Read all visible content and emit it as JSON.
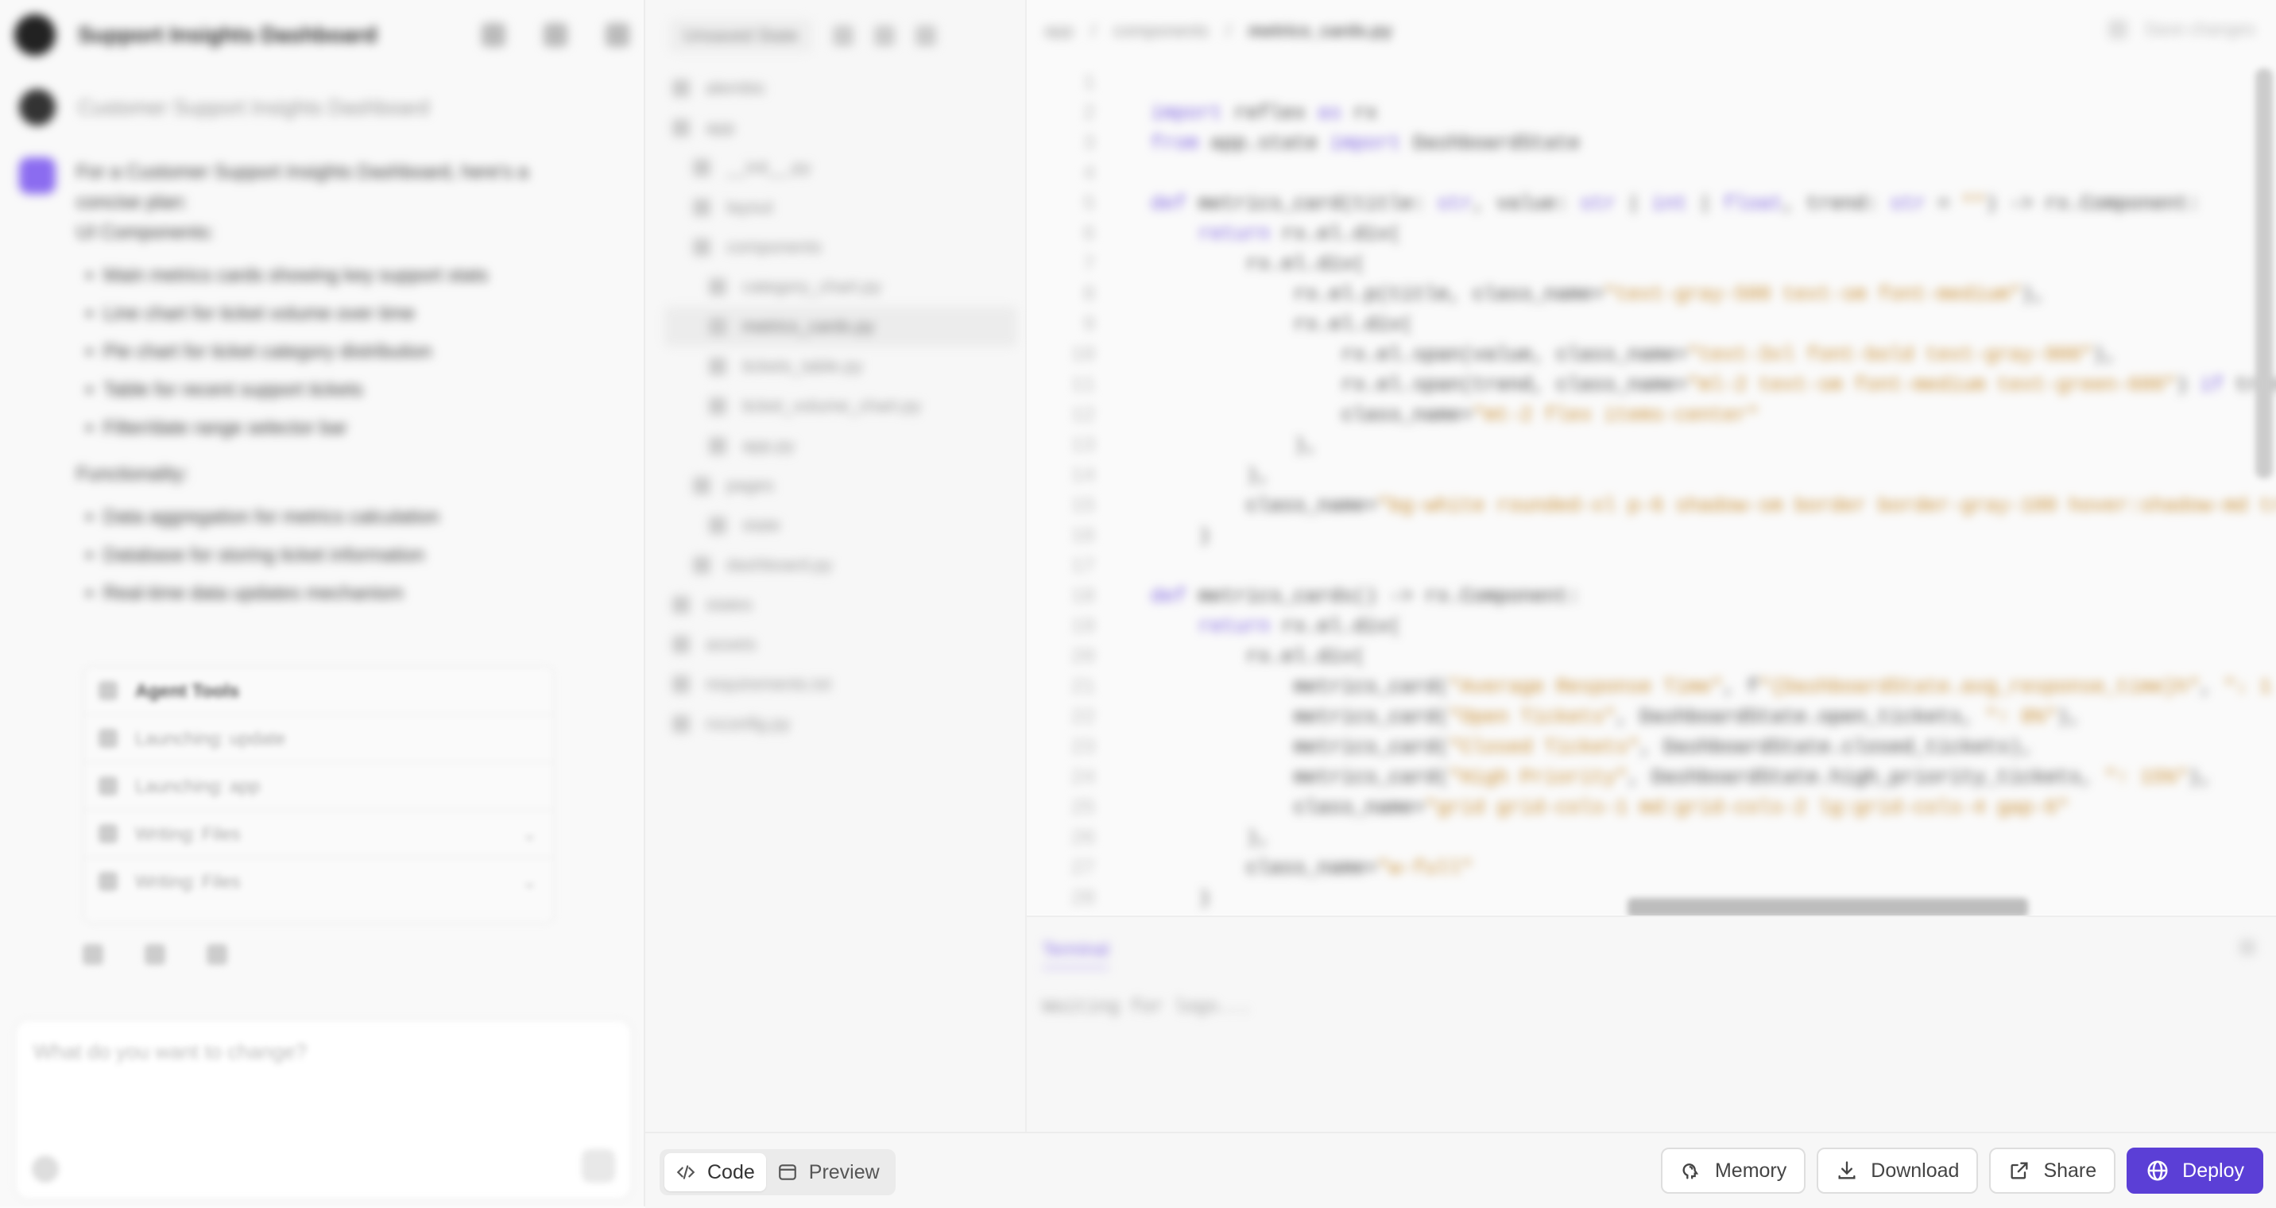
{
  "chat": {
    "project_title": "Support Insights Dashboard",
    "user_prompt": "Customer Support Insights Dashboard",
    "ai_intro": "For a Customer Support Insights Dashboard, here's a concise plan:",
    "ui_heading": "UI Components:",
    "ui_items": [
      "Main metrics cards showing key support stats",
      "Line chart for ticket volume over time",
      "Pie chart for ticket category distribution",
      "Table for recent support tickets",
      "Filter/date range selector bar"
    ],
    "func_heading": "Functionality:",
    "func_items": [
      "Data aggregation for metrics calculation",
      "Database for storing ticket information",
      "Real-time data updates mechanism"
    ],
    "tools_title": "Agent Tools",
    "tools": [
      "Launching: update",
      "Launching: app",
      "Writing: Files",
      "Writing: Files"
    ],
    "composer_placeholder": "What do you want to change?"
  },
  "tree": {
    "branch_chip": "Unsaved State",
    "items": [
      "alembic",
      "app",
      "__init__.py",
      "layout",
      "components",
      "category_chart.py",
      "metrics_cards.py",
      "tickets_table.py",
      "ticket_volume_chart.py",
      "app.py",
      "pages",
      "state",
      "dashboard.py",
      "states",
      "assets",
      "requirements.txt",
      "rxconfig.py"
    ]
  },
  "editor": {
    "breadcrumb": [
      "app",
      "components",
      "metrics_cards.py"
    ],
    "save_label": "Save changes",
    "line_numbers": [
      "1",
      "2",
      "3",
      "4",
      "5",
      "6",
      "7",
      "8",
      "9",
      "10",
      "11",
      "12",
      "13",
      "14",
      "15",
      "16",
      "17",
      "18",
      "19",
      "20",
      "21",
      "22",
      "23",
      "24",
      "25",
      "26",
      "27",
      "28"
    ]
  },
  "terminal": {
    "tab": "Terminal",
    "line": "Waiting for logs..."
  },
  "bottom": {
    "code_tab": "Code",
    "preview_tab": "Preview",
    "memory": "Memory",
    "download": "Download",
    "share": "Share",
    "deploy": "Deploy"
  },
  "colors": {
    "accent": "#5b3fd6",
    "keyword": "#7a5fe0",
    "string": "#c78a2c"
  }
}
